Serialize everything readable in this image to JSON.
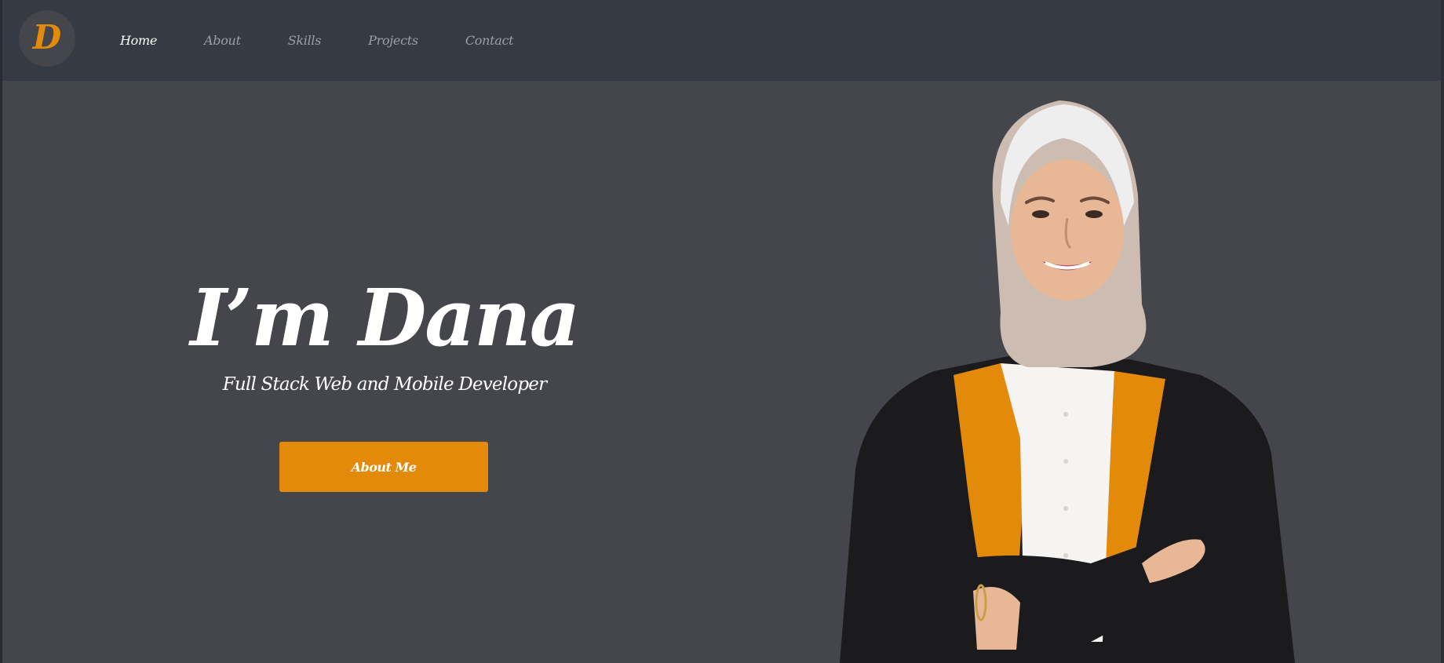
{
  "logo": {
    "letter": "D",
    "color": "#e38a0b"
  },
  "nav": {
    "items": [
      {
        "label": "Home",
        "active": true
      },
      {
        "label": "About",
        "active": false
      },
      {
        "label": "Skills",
        "active": false
      },
      {
        "label": "Projects",
        "active": false
      },
      {
        "label": "Contact",
        "active": false
      }
    ]
  },
  "hero": {
    "title": "I’m Dana",
    "subtitle": "Full Stack Web and Mobile Developer",
    "button_label": "About Me"
  },
  "colors": {
    "accent": "#e38a0b",
    "navbar": "#363a42",
    "background": "#45464c",
    "text": "#ffffff",
    "nav_inactive": "#9aa0a6"
  },
  "portrait": {
    "icon": "person-portrait-photo"
  }
}
